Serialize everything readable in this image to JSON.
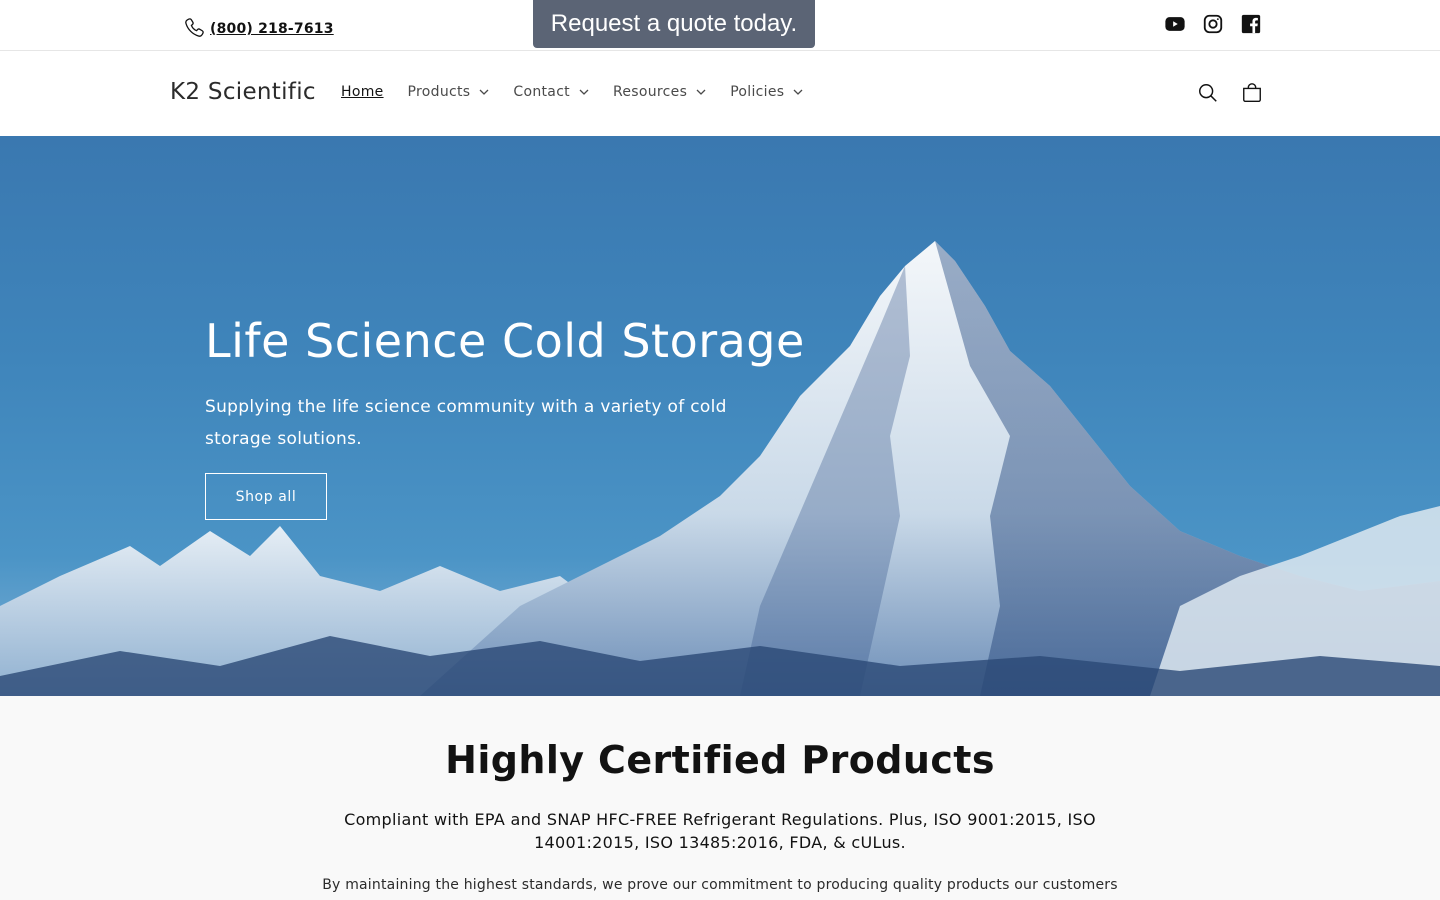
{
  "topbar": {
    "phone_number": "(800) 218-7613",
    "quote_button": "Request a quote today.",
    "social_icons": [
      "youtube-icon",
      "instagram-icon",
      "facebook-icon"
    ]
  },
  "header": {
    "logo": "K2 Scientific",
    "nav": [
      {
        "label": "Home",
        "active": true
      },
      {
        "label": "Products",
        "dropdown": true
      },
      {
        "label": "Contact",
        "dropdown": true
      },
      {
        "label": "Resources",
        "dropdown": true
      },
      {
        "label": "Policies",
        "dropdown": true
      }
    ],
    "icons": [
      "search-icon",
      "cart-icon"
    ]
  },
  "hero": {
    "title": "Life Science Cold Storage",
    "subtitle": "Supplying the life science community with a variety of cold storage solutions.",
    "button": "Shop all"
  },
  "certified": {
    "title": "Highly Certified Products",
    "text": "Compliant with EPA and SNAP HFC-FREE Refrigerant Regulations. Plus, ISO 9001:2015, ISO 14001:2015, ISO 13485:2016, FDA, & cULus.",
    "text2": "By maintaining the highest standards, we prove our commitment to producing quality products our customers can"
  },
  "colors": {
    "quote_button_bg": "#5b6475",
    "hero_sky": "#3f85bb",
    "text": "#121212"
  }
}
